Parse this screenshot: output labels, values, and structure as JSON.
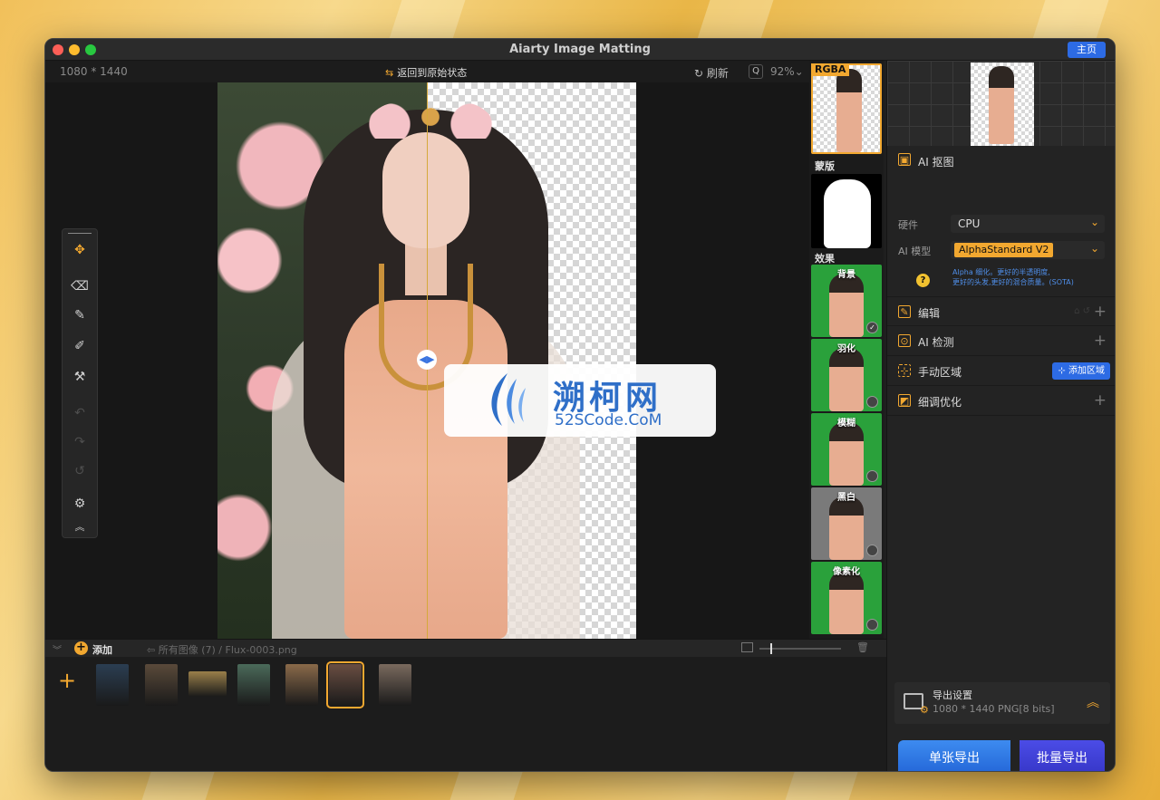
{
  "window": {
    "title": "Aiarty Image Matting",
    "home_button": "主页"
  },
  "canvas": {
    "dimensions": "1080 * 1440",
    "reset_label": "返回到原始状态",
    "refresh_label": "刷新",
    "zoom": "92%"
  },
  "watermark": {
    "name_cn": "溯柯网",
    "domain": "52SCode.CoM"
  },
  "thumbnails": {
    "rgba_label": "RGBA",
    "mask_label": "蒙版",
    "effects_label": "效果",
    "effects": [
      {
        "name": "背景",
        "color": "#2aa13b",
        "checked": true
      },
      {
        "name": "羽化",
        "color": "#2aa13b",
        "checked": false
      },
      {
        "name": "模糊",
        "color": "#2aa13b",
        "checked": false
      },
      {
        "name": "黑白",
        "color": "#7a7a7a",
        "checked": false
      },
      {
        "name": "像素化",
        "color": "#2aa13b",
        "checked": false
      }
    ]
  },
  "panel": {
    "ai_matting": {
      "title": "AI 抠图",
      "hardware_label": "硬件",
      "hardware_value": "CPU",
      "model_label": "AI 模型",
      "model_value": "AlphaStandard  V2",
      "note_line1": "Alpha 细化。更好的半透明度,",
      "note_line2": "更好的头发,更好的混合质量。(SOTA)"
    },
    "edit": {
      "title": "编辑"
    },
    "ai_detect": {
      "title": "AI 检测"
    },
    "manual": {
      "title": "手动区域",
      "add_button": "添加区域"
    },
    "refine": {
      "title": "细调优化"
    },
    "export": {
      "title": "导出设置",
      "detail": "1080 * 1440 PNG[8 bits]",
      "single_button": "单张导出",
      "batch_button": "批量导出"
    }
  },
  "bottom_bar": {
    "add_label": "添加",
    "path": "所有图像 (7) / Flux-0003.png"
  },
  "filmstrip": {
    "selected_index": 5,
    "items": [
      {
        "name": "jellyfish",
        "color": "#2b3e52"
      },
      {
        "name": "warrior",
        "color": "#5a4a3a"
      },
      {
        "name": "bicycle",
        "color": "#9a7f4a"
      },
      {
        "name": "red-dress",
        "color": "#4b6a5a"
      },
      {
        "name": "woman-flowers",
        "color": "#8a6a4a"
      },
      {
        "name": "woman-lace",
        "color": "#6a4e42"
      },
      {
        "name": "woman-portrait",
        "color": "#7a6a5e"
      }
    ]
  },
  "colors": {
    "accent": "#f2a830",
    "primary_blue": "#2d6be4"
  }
}
